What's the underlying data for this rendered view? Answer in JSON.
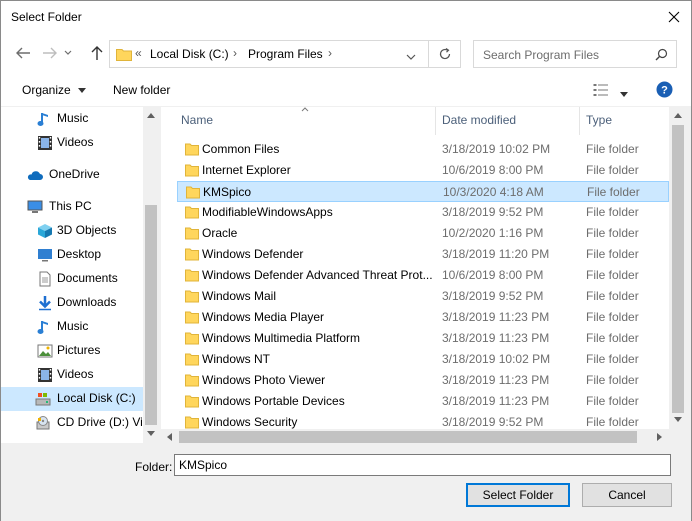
{
  "window": {
    "title": "Select Folder"
  },
  "nav": {
    "breadcrumb": [
      "Local Disk (C:)",
      "Program Files"
    ],
    "search_placeholder": "Search Program Files"
  },
  "toolbar": {
    "organize_label": "Organize",
    "new_folder_label": "New folder"
  },
  "sidebar": {
    "items": [
      {
        "label": "Music",
        "icon": "music-icon"
      },
      {
        "label": "Videos",
        "icon": "videos-icon"
      },
      {
        "label": "OneDrive",
        "icon": "onedrive-icon"
      },
      {
        "label": "This PC",
        "icon": "this-pc-icon"
      },
      {
        "label": "3D Objects",
        "icon": "3d-objects-icon"
      },
      {
        "label": "Desktop",
        "icon": "desktop-icon"
      },
      {
        "label": "Documents",
        "icon": "documents-icon"
      },
      {
        "label": "Downloads",
        "icon": "downloads-icon"
      },
      {
        "label": "Music",
        "icon": "music-icon"
      },
      {
        "label": "Pictures",
        "icon": "pictures-icon"
      },
      {
        "label": "Videos",
        "icon": "videos-icon"
      },
      {
        "label": "Local Disk (C:)",
        "icon": "local-disk-icon"
      },
      {
        "label": "CD Drive (D:) Vir",
        "icon": "cd-drive-icon"
      }
    ]
  },
  "files": {
    "columns": [
      "Name",
      "Date modified",
      "Type"
    ],
    "rows": [
      {
        "name": "Common Files",
        "date": "3/18/2019 10:02 PM",
        "type": "File folder"
      },
      {
        "name": "Internet Explorer",
        "date": "10/6/2019 8:00 PM",
        "type": "File folder"
      },
      {
        "name": "KMSpico",
        "date": "10/3/2020 4:18 AM",
        "type": "File folder"
      },
      {
        "name": "ModifiableWindowsApps",
        "date": "3/18/2019 9:52 PM",
        "type": "File folder"
      },
      {
        "name": "Oracle",
        "date": "10/2/2020 1:16 PM",
        "type": "File folder"
      },
      {
        "name": "Windows Defender",
        "date": "3/18/2019 11:20 PM",
        "type": "File folder"
      },
      {
        "name": "Windows Defender Advanced Threat Prot...",
        "date": "10/6/2019 8:00 PM",
        "type": "File folder"
      },
      {
        "name": "Windows Mail",
        "date": "3/18/2019 9:52 PM",
        "type": "File folder"
      },
      {
        "name": "Windows Media Player",
        "date": "3/18/2019 11:23 PM",
        "type": "File folder"
      },
      {
        "name": "Windows Multimedia Platform",
        "date": "3/18/2019 11:23 PM",
        "type": "File folder"
      },
      {
        "name": "Windows NT",
        "date": "3/18/2019 10:02 PM",
        "type": "File folder"
      },
      {
        "name": "Windows Photo Viewer",
        "date": "3/18/2019 11:23 PM",
        "type": "File folder"
      },
      {
        "name": "Windows Portable Devices",
        "date": "3/18/2019 11:23 PM",
        "type": "File folder"
      },
      {
        "name": "Windows Security",
        "date": "3/18/2019 9:52 PM",
        "type": "File folder"
      }
    ]
  },
  "footer": {
    "folder_label": "Folder:",
    "folder_value": "KMSpico",
    "select_label": "Select Folder",
    "cancel_label": "Cancel"
  }
}
